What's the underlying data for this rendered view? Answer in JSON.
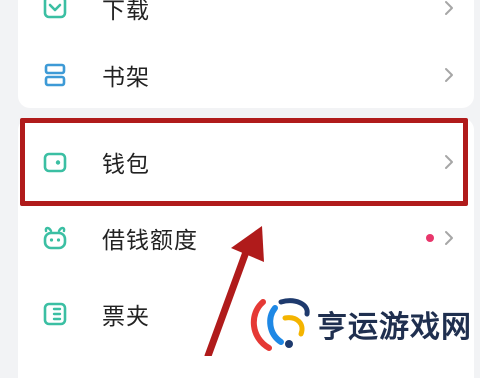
{
  "menu": {
    "items": [
      {
        "label": "下载",
        "icon": "download-icon",
        "chevron": "chevron-right-icon"
      },
      {
        "label": "书架",
        "icon": "bookshelf-icon",
        "chevron": "chevron-right-icon"
      },
      {
        "label": "钱包",
        "icon": "wallet-icon",
        "chevron": "chevron-right-icon",
        "highlighted": true
      },
      {
        "label": "借钱额度",
        "icon": "loan-icon",
        "chevron": "chevron-right-icon",
        "badge": "red-dot"
      },
      {
        "label": "票夹",
        "icon": "ticket-folder-icon",
        "chevron": "chevron-right-icon"
      }
    ]
  },
  "annotation": {
    "highlight_color": "#b01b1b",
    "arrow_color": "#b01b1b"
  },
  "watermark": {
    "text": "亨运游戏网"
  },
  "colors": {
    "icon_teal": "#3bbfa3",
    "icon_blue": "#3d9ad6",
    "badge_red": "#e8366b"
  }
}
